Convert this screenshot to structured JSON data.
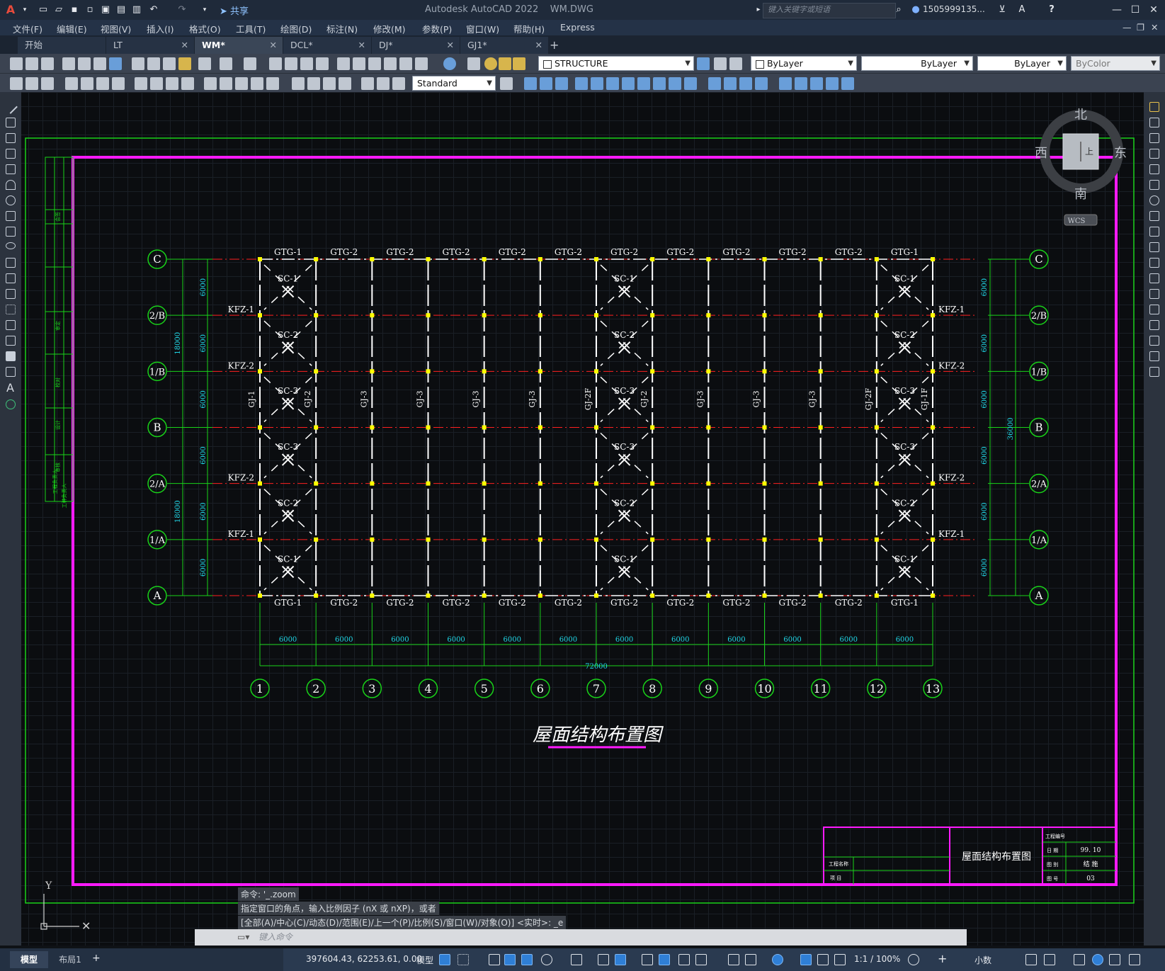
{
  "app": {
    "title": "Autodesk AutoCAD 2022",
    "file": "WM.DWG",
    "share_label": "共享",
    "search_placeholder": "键入关键字或短语",
    "user": "1505999135...",
    "help_icon": "?"
  },
  "menu": [
    "文件(F)",
    "编辑(E)",
    "视图(V)",
    "插入(I)",
    "格式(O)",
    "工具(T)",
    "绘图(D)",
    "标注(N)",
    "修改(M)",
    "参数(P)",
    "窗口(W)",
    "帮助(H)",
    "Express"
  ],
  "tabs": [
    {
      "label": "开始",
      "closable": false
    },
    {
      "label": "LT",
      "closable": true
    },
    {
      "label": "WM*",
      "closable": true,
      "active": true
    },
    {
      "label": "DCL*",
      "closable": true
    },
    {
      "label": "DJ*",
      "closable": true
    },
    {
      "label": "GJ1*",
      "closable": true
    }
  ],
  "toolbar": {
    "layer": "STRUCTURE",
    "color": "ByLayer",
    "linetype": "ByLayer",
    "lineweight": "ByLayer",
    "plotstyle": "ByColor",
    "dimstyle": "Standard"
  },
  "viewcube": {
    "north": "北",
    "south": "南",
    "east": "东",
    "west": "西",
    "face": "上",
    "wcs": "WCS"
  },
  "drawing": {
    "title": "屋面结构布置图",
    "grid_cols": [
      "1",
      "2",
      "3",
      "4",
      "5",
      "6",
      "7",
      "8",
      "9",
      "10",
      "11",
      "12",
      "13"
    ],
    "grid_rows": [
      "C",
      "2/B",
      "1/B",
      "B",
      "2/A",
      "1/A",
      "A"
    ],
    "bay_spacing": "6000",
    "total_length": "72000",
    "total_width": "36000",
    "half_width": "18000",
    "top_beams": [
      "GTG-1",
      "GTG-2",
      "GTG-2",
      "GTG-2",
      "GTG-2",
      "GTG-2",
      "GTG-2",
      "GTG-2",
      "GTG-2",
      "GTG-2",
      "GTG-2",
      "GTG-1"
    ],
    "frames": [
      "GJ-1",
      "GJ-2",
      "GJ-3",
      "GJ-3",
      "GJ-3",
      "GJ-3",
      "GJ-2F",
      "GJ-2",
      "GJ-3",
      "GJ-3",
      "GJ-3",
      "GJ-2F",
      "GJ-1F"
    ],
    "braces": [
      "SC-1",
      "SC-2",
      "SC-3",
      "SC-3",
      "SC-2",
      "SC-1"
    ],
    "wind_cols_left": [
      "KFZ-1",
      "KFZ-2",
      "KFZ-2",
      "KFZ-1"
    ],
    "wind_cols_right": [
      "KFZ-1",
      "KFZ-2",
      "KFZ-2",
      "KFZ-1"
    ],
    "titleblock": {
      "drawing_name": "屋面结构布置图",
      "project_label": "工程名称",
      "item_label": "项 目",
      "no_label": "工程编号",
      "date_label": "日 期",
      "date": "99. 10",
      "type_label": "图 别",
      "type": "结 施",
      "sheet_label": "图 号",
      "sheet": "03"
    },
    "side_labels": [
      "会签",
      "审定",
      "校对",
      "设计",
      "审核",
      "工程负责人",
      "工种负责人"
    ],
    "ucs_y": "Y"
  },
  "command": {
    "history": [
      "命令: '_.zoom",
      "指定窗口的角点，输入比例因子 (nX 或 nXP)，或者",
      "[全部(A)/中心(C)/动态(D)/范围(E)/上一个(P)/比例(S)/窗口(W)/对象(O)] <实时>: _e"
    ],
    "placeholder": "键入命令"
  },
  "status": {
    "model_tab": "模型",
    "layout_tab": "布局1",
    "coords": "397604.43, 62253.61, 0.00",
    "space": "模型",
    "scale": "1:1 / 100%",
    "units": "小数"
  },
  "colors": {
    "green": "#19d219",
    "magenta": "#ff1aff",
    "red": "#ff2020",
    "cyan": "#20d8e8",
    "white": "#ffffff",
    "yellow": "#ffff00"
  }
}
